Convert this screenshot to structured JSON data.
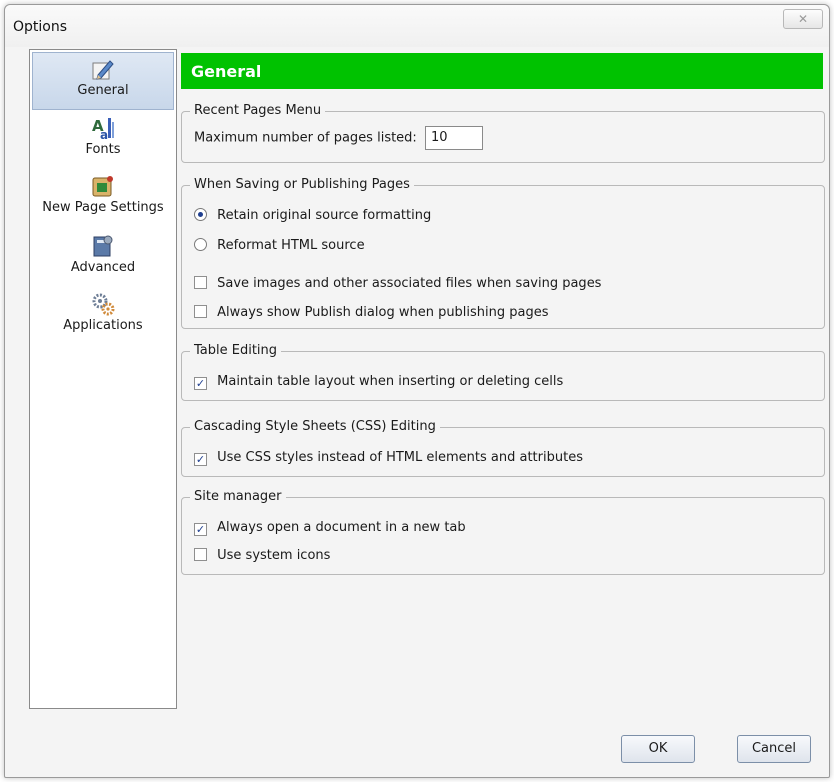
{
  "window": {
    "title": "Options",
    "close_label": "✕"
  },
  "sidebar": {
    "items": [
      {
        "label": "General",
        "icon": "pencil-paper-icon",
        "selected": true
      },
      {
        "label": "Fonts",
        "icon": "font-icon",
        "selected": false
      },
      {
        "label": "New Page Settings",
        "icon": "new-page-icon",
        "selected": false
      },
      {
        "label": "Advanced",
        "icon": "advanced-settings-icon",
        "selected": false
      },
      {
        "label": "Applications",
        "icon": "gears-icon",
        "selected": false
      }
    ]
  },
  "header": {
    "title": "General",
    "color": "#00c200"
  },
  "recent_pages": {
    "legend": "Recent Pages Menu",
    "max_label": "Maximum number of pages listed:",
    "max_value": "10"
  },
  "saving": {
    "legend": "When Saving or Publishing Pages",
    "radio_retain": {
      "label": "Retain original source formatting",
      "checked": true
    },
    "radio_reformat": {
      "label": "Reformat HTML source",
      "checked": false
    },
    "cb_save_images": {
      "label": "Save images and other associated files when saving pages",
      "checked": false
    },
    "cb_publish_dialog": {
      "label": "Always show Publish dialog when publishing pages",
      "checked": false
    }
  },
  "table_editing": {
    "legend": "Table Editing",
    "cb_maintain": {
      "label": "Maintain table layout when inserting or deleting cells",
      "checked": true
    }
  },
  "css_editing": {
    "legend": "Cascading Style Sheets (CSS) Editing",
    "cb_use_css": {
      "label": "Use CSS styles instead of HTML elements and attributes",
      "checked": true
    }
  },
  "site_manager": {
    "legend": "Site manager",
    "cb_new_tab": {
      "label": "Always open a document in a new tab",
      "checked": true
    },
    "cb_system_icons": {
      "label": "Use system icons",
      "checked": false
    }
  },
  "buttons": {
    "ok": "OK",
    "cancel": "Cancel"
  }
}
